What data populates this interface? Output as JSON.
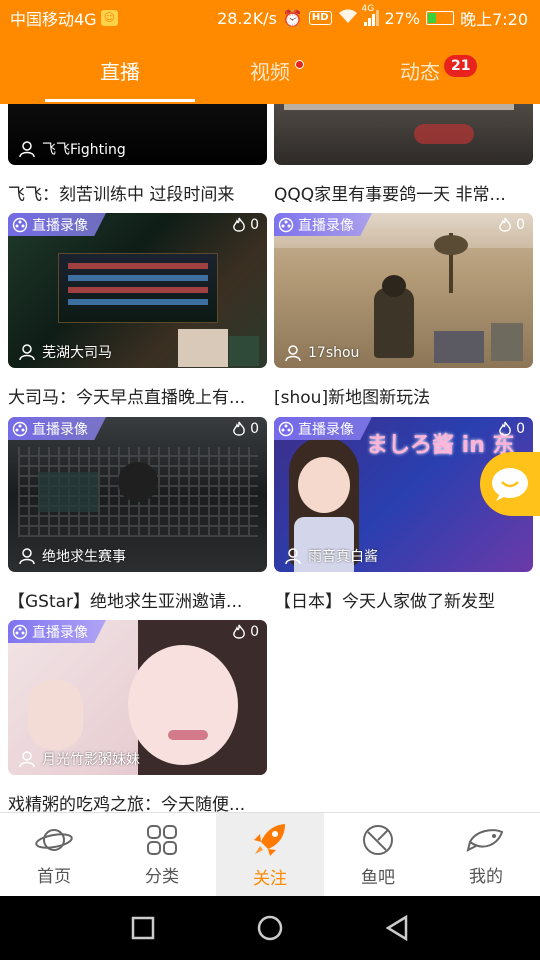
{
  "status": {
    "carrier": "中国移动4G",
    "speed": "28.2K/s",
    "battery_pct": "27%",
    "time": "晚上7:20",
    "hd_label": "HD",
    "net_label": "4G"
  },
  "tabs": [
    {
      "label": "直播"
    },
    {
      "label": "视频"
    },
    {
      "label": "动态",
      "badge": "21"
    }
  ],
  "cards": [
    {
      "streamer": "飞飞Fighting",
      "title": "飞飞：刻苦训练中 过段时间来"
    },
    {
      "streamer": "",
      "title": "QQQ家里有事要鸽一天 非常..."
    },
    {
      "tag": "直播录像",
      "heat": "0",
      "streamer": "芜湖大司马",
      "title": "大司马：今天早点直播晚上有..."
    },
    {
      "tag": "直播录像",
      "heat": "0",
      "streamer": "17shou",
      "title": "[shou]新地图新玩法"
    },
    {
      "tag": "直播录像",
      "heat": "0",
      "streamer": "绝地求生赛事",
      "title": "【GStar】绝地求生亚洲邀请..."
    },
    {
      "tag": "直播录像",
      "heat": "0",
      "streamer": "雨音真白酱",
      "title": "【日本】今天人家做了新发型",
      "overlay": "ましろ酱 in 东"
    },
    {
      "tag": "直播录像",
      "heat": "0",
      "streamer": "月光竹影粥妹妹",
      "title": "戏精粥的吃鸡之旅：今天随便..."
    }
  ],
  "nav": [
    {
      "label": "首页"
    },
    {
      "label": "分类"
    },
    {
      "label": "关注"
    },
    {
      "label": "鱼吧"
    },
    {
      "label": "我的"
    }
  ],
  "colors": {
    "accent": "#ff8a00",
    "badge": "#e8231e",
    "tag": "#7d6ef0"
  }
}
